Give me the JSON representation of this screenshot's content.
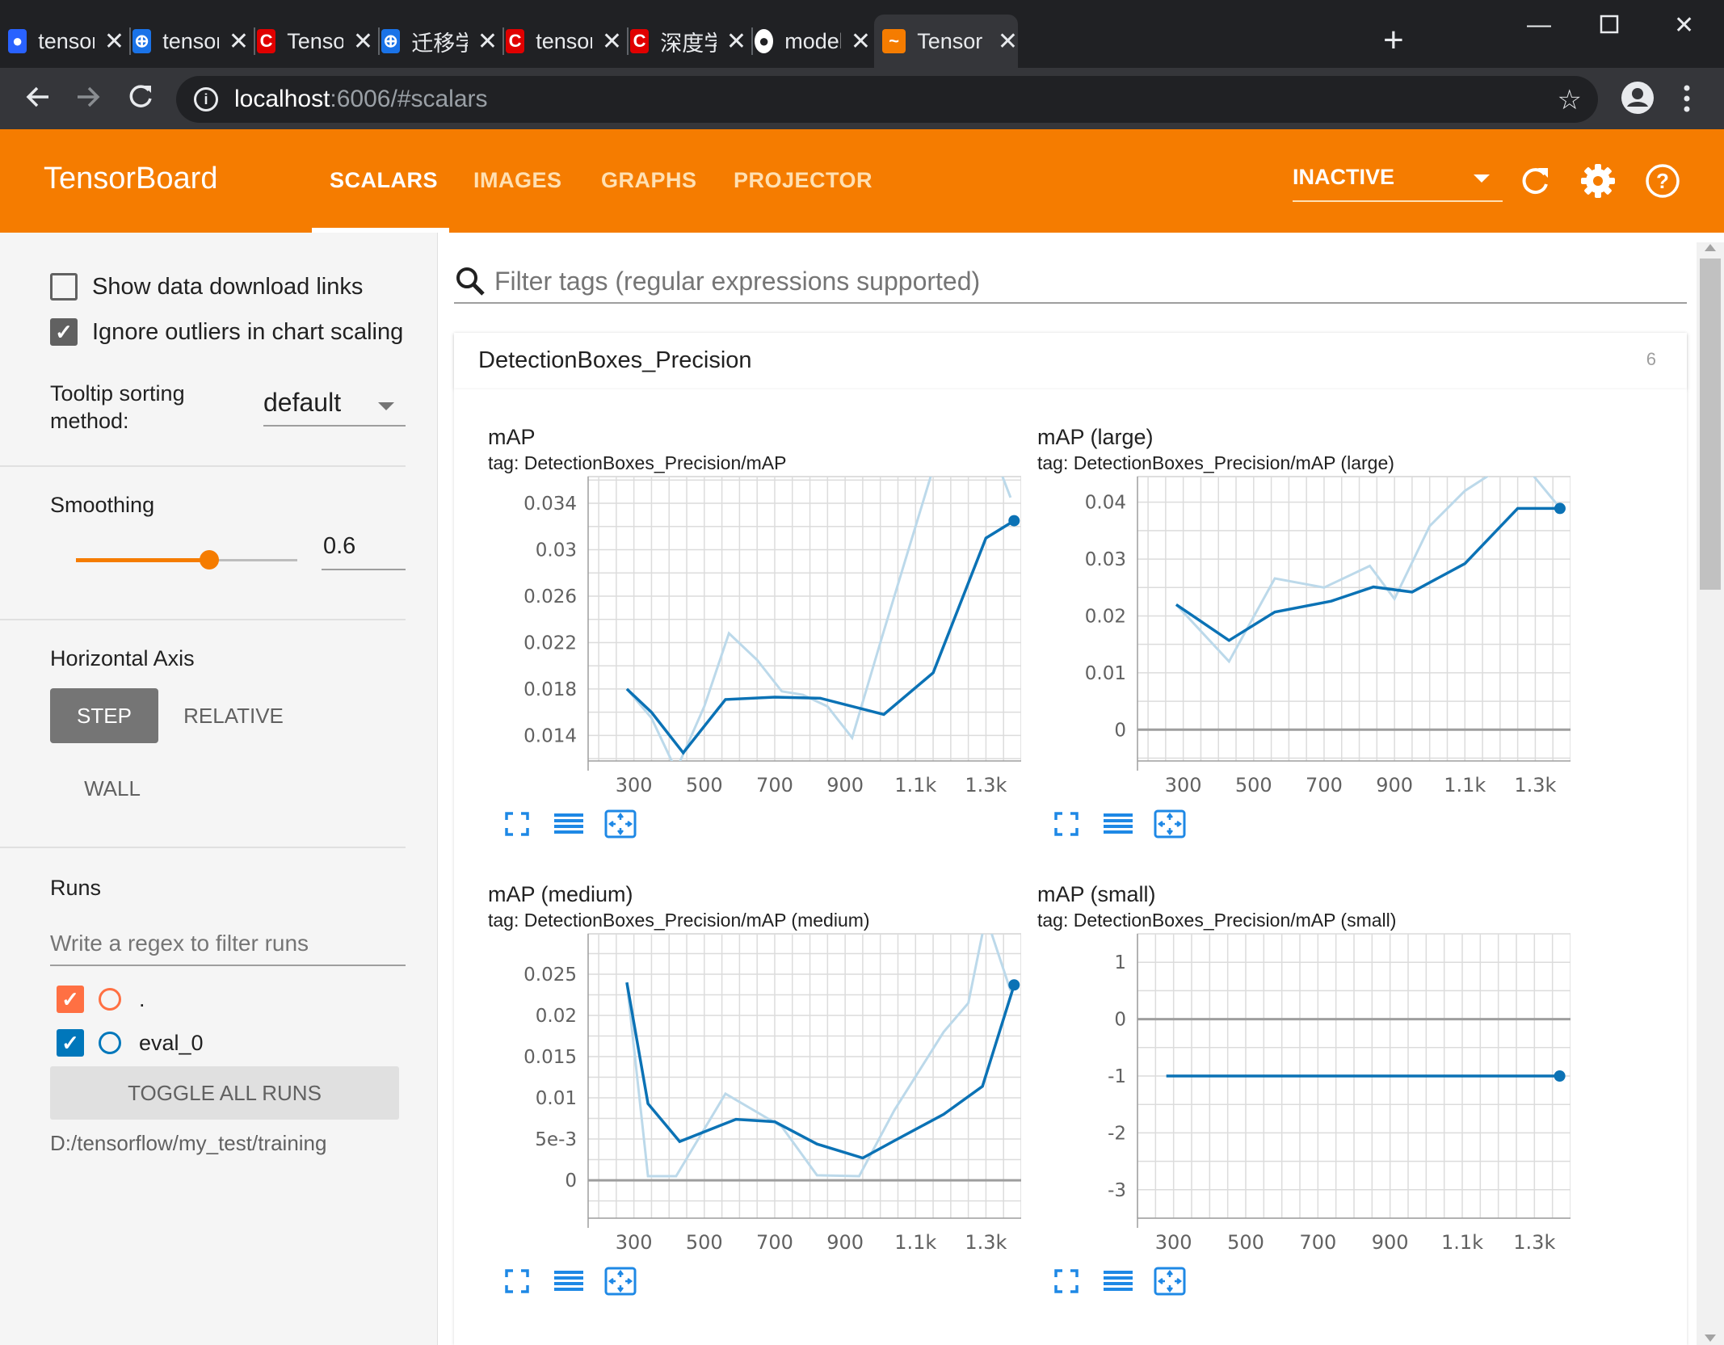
{
  "browser": {
    "tabs": [
      {
        "label": "tensorb",
        "favicon": "paw-icon",
        "color": "#2962ff"
      },
      {
        "label": "tensorb",
        "favicon": "translate-icon",
        "color": "#1a73e8"
      },
      {
        "label": "Tensor",
        "favicon": "csdn-icon",
        "color": "#e00000"
      },
      {
        "label": "迁移学习",
        "favicon": "translate-icon",
        "color": "#1a73e8"
      },
      {
        "label": "tensorf",
        "favicon": "csdn-icon",
        "color": "#e00000"
      },
      {
        "label": "深度学习",
        "favicon": "csdn-icon",
        "color": "#e00000"
      },
      {
        "label": "models",
        "favicon": "github-icon",
        "color": "#ffffff"
      },
      {
        "label": "Tensor",
        "favicon": "tensorboard-icon",
        "color": "#f57c00"
      }
    ],
    "url_host": "localhost",
    "url_path": ":6006/#scalars"
  },
  "header": {
    "brand": "TensorBoard",
    "tabs": [
      "SCALARS",
      "IMAGES",
      "GRAPHS",
      "PROJECTOR"
    ],
    "active_tab": "SCALARS",
    "status": "INACTIVE",
    "accent": "#f57c00"
  },
  "sidebar": {
    "show_download": "Show data download links",
    "ignore_outliers": "Ignore outliers in chart scaling",
    "tooltip_label": "Tooltip sorting method:",
    "tooltip_value": "default",
    "smoothing_label": "Smoothing",
    "smoothing_value": "0.6",
    "smoothing_fraction": 0.6,
    "haxis_label": "Horizontal Axis",
    "haxis_options": [
      "STEP",
      "RELATIVE",
      "WALL"
    ],
    "haxis_selected": "STEP",
    "runs_label": "Runs",
    "runs_filter_placeholder": "Write a regex to filter runs",
    "runs": [
      {
        "name": ".",
        "color": "#ff7043",
        "checked": true
      },
      {
        "name": "eval_0",
        "color": "#0077bb",
        "checked": true
      }
    ],
    "toggle_all": "TOGGLE ALL RUNS",
    "logdir": "D:/tensorflow/my_test/training"
  },
  "main": {
    "filter_placeholder": "Filter tags (regular expressions supported)",
    "category": "DetectionBoxes_Precision",
    "category_count": "6"
  },
  "chart_data": [
    {
      "type": "line",
      "title": "mAP",
      "tag": "tag: DetectionBoxes_Precision/mAP",
      "x_ticks": [
        "300",
        "500",
        "700",
        "900",
        "1.1k",
        "1.3k"
      ],
      "y_ticks": [
        "0.034",
        "0.03",
        "0.026",
        "0.022",
        "0.018",
        "0.014"
      ],
      "xlim": [
        170,
        1400
      ],
      "ylim": [
        0.0118,
        0.0363
      ],
      "series": [
        {
          "role": "raw",
          "x": [
            280,
            350,
            420,
            500,
            570,
            650,
            720,
            780,
            850,
            920,
            1000,
            1060,
            1120,
            1180,
            1250,
            1300,
            1370
          ],
          "y": [
            0.018,
            0.0155,
            0.011,
            0.0165,
            0.0228,
            0.0205,
            0.0178,
            0.0175,
            0.0165,
            0.0138,
            0.022,
            0.028,
            0.034,
            0.04,
            0.042,
            0.04,
            0.0345
          ]
        },
        {
          "role": "smoothed",
          "x": [
            280,
            350,
            440,
            560,
            700,
            830,
            1010,
            1150,
            1300,
            1380
          ],
          "y": [
            0.018,
            0.016,
            0.0125,
            0.0171,
            0.0173,
            0.0172,
            0.0158,
            0.0194,
            0.031,
            0.0325
          ]
        }
      ]
    },
    {
      "type": "line",
      "title": "mAP (large)",
      "tag": "tag: DetectionBoxes_Precision/mAP (large)",
      "x_ticks": [
        "300",
        "500",
        "700",
        "900",
        "1.1k",
        "1.3k"
      ],
      "y_ticks": [
        "0.04",
        "0.03",
        "0.02",
        "0.01",
        "0"
      ],
      "xlim": [
        170,
        1400
      ],
      "ylim": [
        -0.0055,
        0.0445
      ],
      "series": [
        {
          "role": "raw",
          "x": [
            280,
            430,
            560,
            700,
            830,
            900,
            1000,
            1100,
            1250,
            1370
          ],
          "y": [
            0.022,
            0.012,
            0.0266,
            0.025,
            0.0288,
            0.023,
            0.0358,
            0.042,
            0.048,
            0.039
          ]
        },
        {
          "role": "smoothed",
          "x": [
            280,
            430,
            560,
            720,
            840,
            950,
            1100,
            1250,
            1370
          ],
          "y": [
            0.022,
            0.0157,
            0.0207,
            0.0226,
            0.0251,
            0.0242,
            0.0292,
            0.0389,
            0.0389
          ]
        }
      ]
    },
    {
      "type": "line",
      "title": "mAP (medium)",
      "tag": "tag: DetectionBoxes_Precision/mAP (medium)",
      "x_ticks": [
        "300",
        "500",
        "700",
        "900",
        "1.1k",
        "1.3k"
      ],
      "y_ticks": [
        "0.025",
        "0.02",
        "0.015",
        "0.01",
        "5e-3",
        "0"
      ],
      "xlim": [
        170,
        1400
      ],
      "ylim": [
        -0.0046,
        0.0299
      ],
      "series": [
        {
          "role": "raw",
          "x": [
            280,
            340,
            420,
            560,
            720,
            820,
            940,
            1040,
            1180,
            1250,
            1300,
            1370
          ],
          "y": [
            0.024,
            0.0005,
            0.0005,
            0.0105,
            0.0065,
            0.0006,
            0.0005,
            0.0085,
            0.018,
            0.0215,
            0.032,
            0.023
          ]
        },
        {
          "role": "smoothed",
          "x": [
            280,
            340,
            430,
            590,
            700,
            820,
            950,
            1040,
            1180,
            1290,
            1380
          ],
          "y": [
            0.024,
            0.0093,
            0.0047,
            0.0074,
            0.0071,
            0.0044,
            0.0027,
            0.0048,
            0.008,
            0.0114,
            0.0237
          ]
        }
      ]
    },
    {
      "type": "line",
      "title": "mAP (small)",
      "tag": "tag: DetectionBoxes_Precision/mAP (small)",
      "x_ticks": [
        "300",
        "500",
        "700",
        "900",
        "1.1k",
        "1.3k"
      ],
      "y_ticks": [
        "1",
        "0",
        "-1",
        "-2",
        "-3"
      ],
      "xlim": [
        200,
        1400
      ],
      "ylim": [
        -3.5,
        1.5
      ],
      "series": [
        {
          "role": "raw",
          "x": [
            280,
            1370
          ],
          "y": [
            -1,
            -1
          ]
        },
        {
          "role": "smoothed",
          "x": [
            280,
            1370
          ],
          "y": [
            -1,
            -1
          ]
        }
      ]
    }
  ]
}
